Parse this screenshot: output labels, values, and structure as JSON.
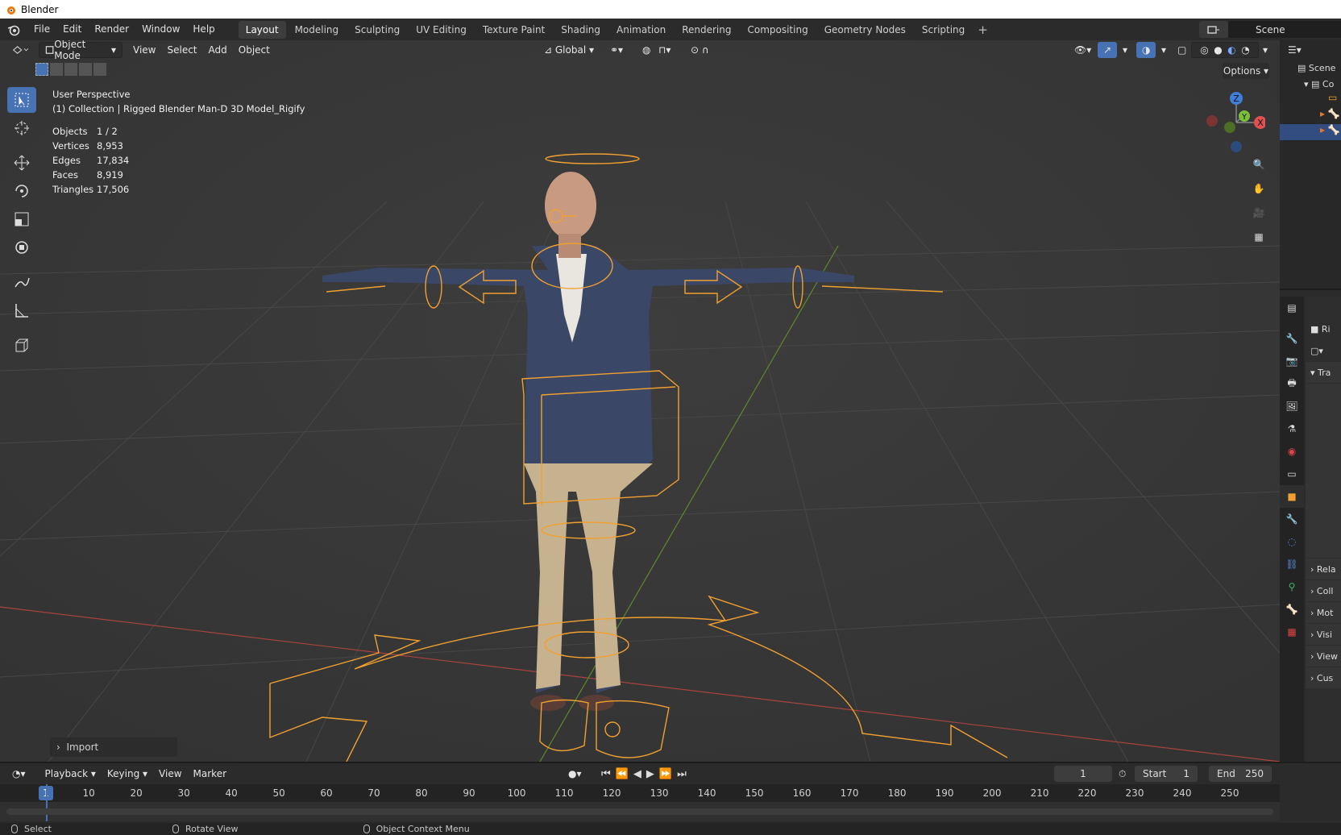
{
  "window": {
    "title": "Blender"
  },
  "menu": {
    "items": [
      "File",
      "Edit",
      "Render",
      "Window",
      "Help"
    ]
  },
  "workspaces": [
    "Layout",
    "Modeling",
    "Sculpting",
    "UV Editing",
    "Texture Paint",
    "Shading",
    "Animation",
    "Rendering",
    "Compositing",
    "Geometry Nodes",
    "Scripting"
  ],
  "active_workspace": "Layout",
  "scene": {
    "name": "Scene"
  },
  "viewport": {
    "mode": "Object Mode",
    "menus": [
      "View",
      "Select",
      "Add",
      "Object"
    ],
    "transform_orientation": "Global",
    "options_label": "Options",
    "view_name": "User Perspective",
    "collection_line": "(1) Collection | Rigged Blender Man-D 3D Model_Rigify",
    "stats": [
      {
        "label": "Objects",
        "value": "1 / 2"
      },
      {
        "label": "Vertices",
        "value": "8,953"
      },
      {
        "label": "Edges",
        "value": "17,834"
      },
      {
        "label": "Faces",
        "value": "8,919"
      },
      {
        "label": "Triangles",
        "value": "17,506"
      }
    ],
    "import_panel": "Import",
    "gizmo": {
      "x": "X",
      "y": "Y",
      "z": "Z"
    }
  },
  "outliner": {
    "scene_label": "Scene",
    "collection_label": "Co"
  },
  "properties": {
    "object_name_prefix": "Ri",
    "sections": [
      "Tra",
      "Rela",
      "Coll",
      "Mot",
      "Visi",
      "View",
      "Cus"
    ]
  },
  "timeline": {
    "menus": [
      "Playback",
      "Keying",
      "View",
      "Marker"
    ],
    "current_frame": "1",
    "start_label": "Start",
    "start_value": "1",
    "end_label": "End",
    "end_value": "250",
    "ticks": [
      "10",
      "20",
      "30",
      "40",
      "50",
      "60",
      "70",
      "80",
      "90",
      "100",
      "110",
      "120",
      "130",
      "140",
      "150",
      "160",
      "170",
      "180",
      "190",
      "200",
      "210",
      "220",
      "230",
      "240",
      "250"
    ]
  },
  "statusbar": {
    "select": "Select",
    "rotate": "Rotate View",
    "context": "Object Context Menu"
  },
  "colors": {
    "accent": "#4772b3",
    "rig": "#f0a030",
    "x_axis": "#e05252",
    "y_axis": "#7bbf3a",
    "z_axis": "#3f7fd9"
  }
}
